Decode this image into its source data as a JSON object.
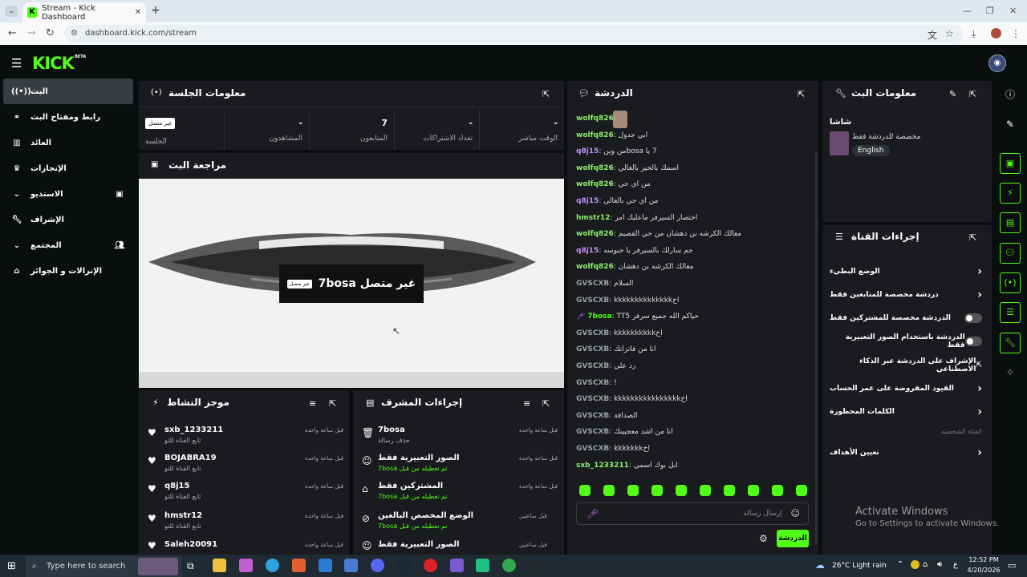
{
  "browser": {
    "tab_title": "Stream - Kick Dashboard",
    "url": "dashboard.kick.com/stream"
  },
  "header": {
    "logo": "KICK",
    "beta": "BETA"
  },
  "sidebar": {
    "items": [
      {
        "label": "البث",
        "icon": "broadcast-icon"
      },
      {
        "label": "رابط ومفتاح البث",
        "icon": "link-icon"
      },
      {
        "label": "العائد",
        "icon": "chart-icon"
      },
      {
        "label": "الإنجازات",
        "icon": "trophy-icon"
      },
      {
        "label": "الاستديو",
        "icon": "studio-icon"
      },
      {
        "label": "الإشراف",
        "icon": "wrench-icon"
      },
      {
        "label": "المجتمع",
        "icon": "community-icon"
      },
      {
        "label": "الإنزالات و الجوائز",
        "icon": "gift-icon"
      }
    ]
  },
  "session": {
    "title": "معلومات الجلسة",
    "stats": [
      {
        "value": "-",
        "label": "الوقت مباشر"
      },
      {
        "value": "-",
        "label": "تعداد الاشتراكات"
      },
      {
        "value": "7",
        "label": "المتابعون"
      },
      {
        "value": "-",
        "label": "المشاهدون"
      }
    ],
    "status_badge": "غير متصل",
    "status_label": "الجلسة"
  },
  "preview": {
    "title": "مراجعة البث",
    "offline_text": "7bosa غير متصل",
    "offline_badge": "غير متصل"
  },
  "activity": {
    "title": "موجز النشاط",
    "rows": [
      {
        "name": "sxb_1233211",
        "sub": "تابع القناة للتو",
        "time": "قبل ساعة واحدة"
      },
      {
        "name": "BOJABRA19",
        "sub": "تابع القناة للتو",
        "time": "قبل ساعة واحدة"
      },
      {
        "name": "q8j15",
        "sub": "تابع القناة للتو",
        "time": "قبل ساعة واحدة"
      },
      {
        "name": "hmstr12",
        "sub": "تابع القناة للتو",
        "time": "قبل ساعة واحدة"
      },
      {
        "name": "Saleh20091",
        "sub": "",
        "time": "قبل ساعة واحدة"
      }
    ]
  },
  "mod_actions": {
    "title": "إجراءات المشرف",
    "rows": [
      {
        "name": "7bosa",
        "sub": "حذف رسالة",
        "time": "قبل ساعة واحدة",
        "icon": "trash-icon"
      },
      {
        "name": "الصور التعبيرية فقط",
        "sub": "تم تعطيله من قبل 7bosa",
        "time": "قبل ساعة واحدة",
        "icon": "emoji-icon"
      },
      {
        "name": "المشتركين فقط",
        "sub": "تم تعطيله من قبل 7bosa",
        "time": "قبل ساعة واحدة",
        "icon": "gift-icon"
      },
      {
        "name": "الوضع المخصص البالغين",
        "sub": "تم تعطيله من قبل 7bosa",
        "time": "قبل ساعتين",
        "icon": "eye-off-icon"
      },
      {
        "name": "الصور التعبيرية فقط",
        "sub": "",
        "time": "قبل ساعتين",
        "icon": "emoji-icon"
      }
    ]
  },
  "chat": {
    "title": "الدردشة",
    "messages": [
      {
        "user": "wolfq826",
        "color": "#8cf06a",
        "text": ""
      },
      {
        "user": "wolfq826",
        "color": "#8cf06a",
        "text": "ابي جدول"
      },
      {
        "user": "q8j15",
        "color": "#c58cf5",
        "text": "7 يا bosaمن وين"
      },
      {
        "user": "wolfq826",
        "color": "#8cf06a",
        "text": "اسمك بالخير بالغالي"
      },
      {
        "user": "wolfq826",
        "color": "#8cf06a",
        "text": "من اي حي"
      },
      {
        "user": "q8j15",
        "color": "#c58cf5",
        "text": "من اي حي بالغالي"
      },
      {
        "user": "hmstr12",
        "color": "#8cf06a",
        "text": "اختصار السيرفر ماعليك امر"
      },
      {
        "user": "wolfq826",
        "color": "#8cf06a",
        "text": "معالك الكرشه بن دهشان من حي القصيم"
      },
      {
        "user": "q8j15",
        "color": "#c58cf5",
        "text": "جم سارلك بالسيرفر يا حبوسه"
      },
      {
        "user": "wolfq826",
        "color": "#8cf06a",
        "text": "معالك الكرشه بن دهشان"
      },
      {
        "user": "GVSCXB",
        "color": "#9aa0a6",
        "text": "السلام"
      },
      {
        "user": "GVSCXB",
        "color": "#9aa0a6",
        "text": "اخkkkkkkkkkkkkkk"
      },
      {
        "user": "7bosa",
        "color": "#53fc18",
        "text": "حياكم الله جميع سرفر TT5"
      },
      {
        "user": "GVSCXB",
        "color": "#9aa0a6",
        "text": "اخkkkkkkkkkk"
      },
      {
        "user": "GVSCXB",
        "color": "#9aa0a6",
        "text": "انا من فاتزانك"
      },
      {
        "user": "GVSCXB",
        "color": "#9aa0a6",
        "text": "رد علي"
      },
      {
        "user": "GVSCXB",
        "color": "#9aa0a6",
        "text": "!"
      },
      {
        "user": "GVSCXB",
        "color": "#9aa0a6",
        "text": "اخkkkkkkkkkkkkkkkk"
      },
      {
        "user": "GVSCXB",
        "color": "#9aa0a6",
        "text": "الصدافة"
      },
      {
        "user": "GVSCXB",
        "color": "#9aa0a6",
        "text": "انا من اشد معجبينك"
      },
      {
        "user": "GVSCXB",
        "color": "#9aa0a6",
        "text": "اخkkkkkkk"
      },
      {
        "user": "sxb_1233211",
        "color": "#8cf06a",
        "text": "ابل بوك اسمي"
      }
    ],
    "input_placeholder": "إرسال رسالة",
    "send_label": "الدردشة"
  },
  "stream_info": {
    "title": "معلومات البث",
    "stream_title": "شاشا",
    "category": "مخصصة للدردشة فقط",
    "language": "English"
  },
  "channel_actions": {
    "title": "إجراءات القناة",
    "items": [
      {
        "label": "الوضع البطيء",
        "control": "chevron"
      },
      {
        "label": "دردشة مخصصة للمتابعين فقط",
        "control": "chevron"
      },
      {
        "label": "الدردشة مخصصة للمشتركين فقط",
        "control": "toggle"
      },
      {
        "label": "الدردشة باستخدام الصور التعبيرية فقط",
        "control": "toggle"
      },
      {
        "label": "الإشراف على الدردشة عبر الذكاء الاصطناعي",
        "control": "external"
      },
      {
        "label": "القيود المفروضة على عمر الحساب",
        "control": "chevron"
      },
      {
        "label": "الكلمات المحظورة",
        "control": "chevron"
      }
    ],
    "subheading": "القناة الشخصية",
    "goals_label": "تعيين الأهداف"
  },
  "watermark": {
    "line1": "Activate Windows",
    "line2": "Go to Settings to activate Windows."
  },
  "taskbar": {
    "search_placeholder": "Type here to search",
    "weather": "26°C  Light rain",
    "time": "12:52 PM",
    "date": "4/20/2026"
  },
  "colors": {
    "accent": "#53fc18",
    "panel": "#191b1f",
    "background": "#0b0e0f"
  }
}
